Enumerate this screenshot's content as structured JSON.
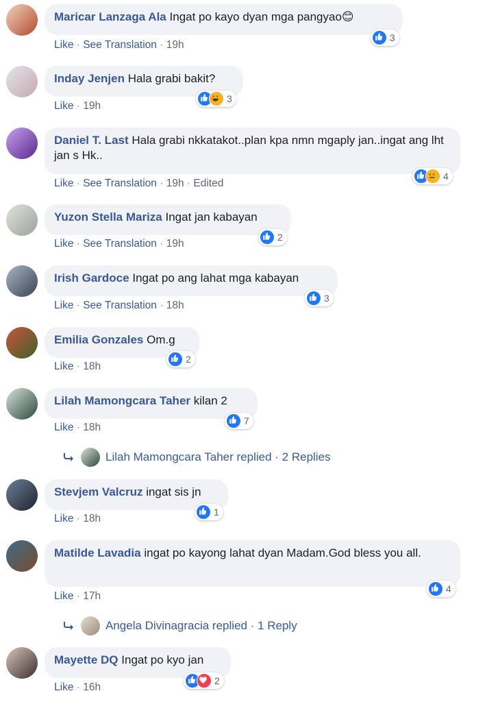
{
  "comments": [
    {
      "name": "Maricar Lanzaga Ala",
      "text": "Ingat po kayo dyan mga pangyao😊",
      "actions": [
        "Like",
        "See Translation",
        "19h"
      ],
      "reactions": [
        "like"
      ],
      "count": "3",
      "avatar_colors": [
        "#b24a2e",
        "#f1d3bd"
      ]
    },
    {
      "name": "Inday Jenjen",
      "text": "Hala grabi bakit?",
      "actions": [
        "Like",
        "19h"
      ],
      "reactions": [
        "like",
        "haha"
      ],
      "count": "3",
      "avatar_colors": [
        "#c7a9b0",
        "#e3e3e8"
      ]
    },
    {
      "name": "Daniel T. Last",
      "text": "Hala grabi nkkatakot..plan kpa nmn mgaply jan..ingat ang lht jan s Hk..",
      "actions": [
        "Like",
        "See Translation",
        "19h",
        "Edited"
      ],
      "reactions": [
        "like",
        "sad"
      ],
      "count": "4",
      "avatar_colors": [
        "#5a2a8c",
        "#c7a0f0"
      ]
    },
    {
      "name": "Yuzon Stella Mariza",
      "text": "Ingat jan kabayan",
      "actions": [
        "Like",
        "See Translation",
        "19h"
      ],
      "reactions": [
        "like"
      ],
      "count": "2",
      "avatar_colors": [
        "#9aa19b",
        "#dfe4dd"
      ]
    },
    {
      "name": "Irish Gardoce",
      "text": "Ingat po ang lahat mga kabayan",
      "actions": [
        "Like",
        "See Translation",
        "18h"
      ],
      "reactions": [
        "like"
      ],
      "count": "3",
      "avatar_colors": [
        "#394452",
        "#a9b6c2"
      ]
    },
    {
      "name": "Emilia Gonzales",
      "text": "Om.g",
      "actions": [
        "Like",
        "18h"
      ],
      "reactions": [
        "like"
      ],
      "count": "2",
      "avatar_colors": [
        "#3f5f2a",
        "#c8573c"
      ]
    },
    {
      "name": "Lilah Mamongcara Taher",
      "text": "kilan 2",
      "actions": [
        "Like",
        "18h"
      ],
      "reactions": [
        "like"
      ],
      "count": "7",
      "avatar_colors": [
        "#2d4a3a",
        "#d9e0dc"
      ],
      "replies": {
        "text": "Lilah Mamongcara Taher replied · 2 Replies"
      }
    },
    {
      "name": "Stevjem Valcruz",
      "text": "ingat sis jn",
      "actions": [
        "Like",
        "18h"
      ],
      "reactions": [
        "like"
      ],
      "count": "1",
      "avatar_colors": [
        "#1d2430",
        "#6d7f95"
      ]
    },
    {
      "name": "Matilde Lavadia",
      "text": "ingat po kayong lahat dyan Madam.God bless you all.",
      "actions": [
        "Like",
        "17h"
      ],
      "reactions": [
        "like"
      ],
      "count": "4",
      "avatar_colors": [
        "#7a4a2c",
        "#3c6e8a"
      ],
      "replies": {
        "text": "Angela Divinagracia replied · 1 Reply"
      }
    },
    {
      "name": "Mayette DQ",
      "text": "Ingat po kyo jan",
      "actions": [
        "Like",
        "16h"
      ],
      "reactions": [
        "like",
        "love"
      ],
      "count": "2",
      "avatar_colors": [
        "#3a3030",
        "#d8c4bb"
      ]
    }
  ],
  "reply_avatar_colors": [
    [
      "#2d4a3a",
      "#d9e0dc"
    ],
    [
      "#9e8c78",
      "#e2dcd3"
    ]
  ]
}
